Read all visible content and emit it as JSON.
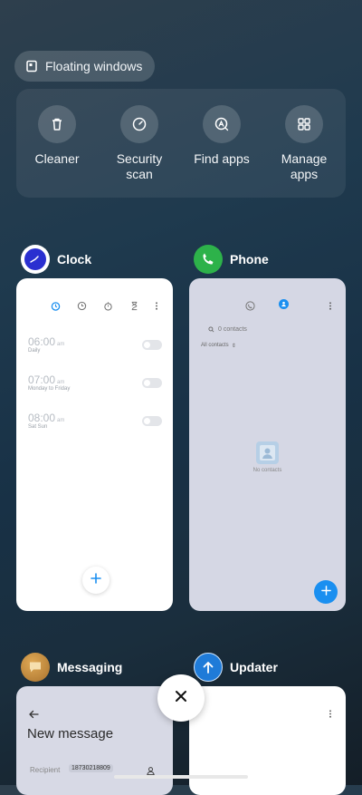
{
  "floating_windows": {
    "label": "Floating windows",
    "icon": "floating-window-icon"
  },
  "quick_actions": [
    {
      "label": "Cleaner",
      "icon": "trash-icon"
    },
    {
      "label": "Security\nscan",
      "icon": "gauge-icon"
    },
    {
      "label": "Find apps",
      "icon": "app-search-icon"
    },
    {
      "label": "Manage\napps",
      "icon": "grid-icon"
    }
  ],
  "apps": {
    "clock": {
      "name": "Clock",
      "alarms": [
        {
          "time": "06:00",
          "ampm": "am",
          "repeat": "Daily"
        },
        {
          "time": "07:00",
          "ampm": "am",
          "repeat": "Monday to Friday"
        },
        {
          "time": "08:00",
          "ampm": "am",
          "repeat": "Sat Sun"
        }
      ]
    },
    "phone": {
      "name": "Phone",
      "search_placeholder": "0 contacts",
      "filter": "All contacts",
      "empty_text": "No contacts"
    },
    "messaging": {
      "name": "Messaging",
      "title": "New message",
      "recipient_label": "Recipient",
      "recipient_value": "18730218809"
    },
    "updater": {
      "name": "Updater"
    }
  },
  "colors": {
    "accent_blue": "#1a8ff0",
    "clock_icon": "#2a2fd0",
    "phone_icon": "#2db24a",
    "messaging_icon": "#c58a3a",
    "updater_icon": "#1f7bd8"
  }
}
